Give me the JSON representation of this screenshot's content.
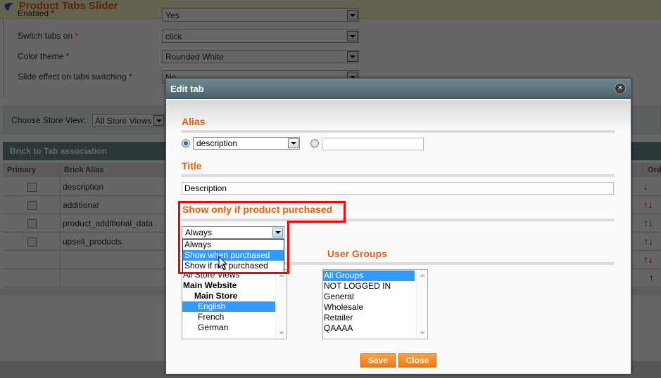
{
  "page": {
    "title": "Product Tabs Slider",
    "form_rows": [
      {
        "label": "Enabled",
        "required": true,
        "value": "Yes"
      },
      {
        "label": "Switch tabs on",
        "required": true,
        "value": "click"
      },
      {
        "label": "Color theme",
        "required": true,
        "value": "Rounded White"
      },
      {
        "label": "Slide effect on tabs switching",
        "required": true,
        "value": "No"
      }
    ],
    "required_mark": "*",
    "store_switcher": {
      "label": "Choose Store View:",
      "value": "All Store Views"
    },
    "grid": {
      "title": "Brick to Tab association",
      "columns": [
        "Primary",
        "Brick Alias",
        "Order"
      ],
      "rows": [
        {
          "alias": "description",
          "arrows": "down"
        },
        {
          "alias": "additional",
          "arrows": "up-down"
        },
        {
          "alias": "product_additional_data",
          "arrows": "up-down"
        },
        {
          "alias": "upsell_products",
          "arrows": "up-down"
        },
        {
          "alias": "",
          "arrows": "up-down"
        },
        {
          "alias": "",
          "arrows": "up"
        }
      ]
    }
  },
  "dialog": {
    "title": "Edit tab",
    "close_icon": "×",
    "alias": {
      "label": "Alias",
      "select_value": "description",
      "custom_value": ""
    },
    "title_field": {
      "label": "Title",
      "value": "Description"
    },
    "purchase": {
      "label": "Show only if product purchased",
      "value": "Always",
      "options": [
        "Always",
        "Show when purchased",
        "Show if not purchased"
      ],
      "highlighted_option": "Show when purchased"
    },
    "store_views": {
      "items": [
        {
          "text": "All Store Views",
          "style": "plain",
          "selected": false
        },
        {
          "text": "Main Website",
          "style": "bold",
          "selected": false
        },
        {
          "text": "Main Store",
          "style": "bold-indent",
          "selected": false
        },
        {
          "text": "English",
          "style": "indent2",
          "selected": true
        },
        {
          "text": "French",
          "style": "indent2",
          "selected": false
        },
        {
          "text": "German",
          "style": "indent2",
          "selected": false
        }
      ]
    },
    "user_groups": {
      "label": "User Groups",
      "items": [
        {
          "text": "All Groups",
          "selected": true
        },
        {
          "text": "NOT LOGGED IN",
          "selected": false
        },
        {
          "text": "General",
          "selected": false
        },
        {
          "text": "Wholesale",
          "selected": false
        },
        {
          "text": "Retailer",
          "selected": false
        },
        {
          "text": "QAAAA",
          "selected": false
        }
      ]
    },
    "buttons": {
      "save": "Save",
      "close": "Close"
    }
  },
  "colors": {
    "accent_orange": "#e85d0c",
    "highlight_red": "#ff0000",
    "selection_blue": "#3399ff",
    "header_teal": "#6f8992"
  }
}
